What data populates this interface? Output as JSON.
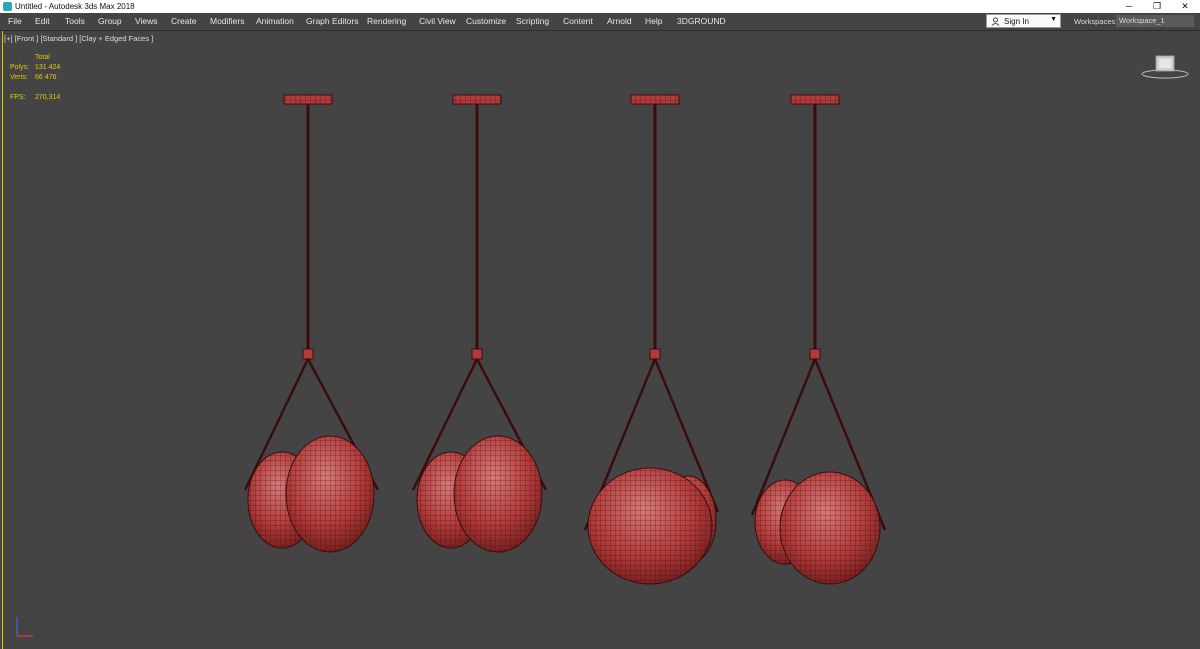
{
  "window": {
    "title": "Untitled - Autodesk 3ds Max 2018",
    "controls": {
      "minimize": "─",
      "restore": "❐",
      "close": "✕"
    }
  },
  "menu": {
    "items": [
      "File",
      "Edit",
      "Tools",
      "Group",
      "Views",
      "Create",
      "Modifiers",
      "Animation",
      "Graph Editors",
      "Rendering",
      "Civil View",
      "Customize",
      "Scripting",
      "Content",
      "Arnold",
      "Help",
      "3DGROUND"
    ]
  },
  "account": {
    "sign_in": "Sign In"
  },
  "workspaces": {
    "label": "Workspaces:",
    "value": "Workspace_1"
  },
  "viewport": {
    "label": "[+] [Front ] [Standard ] [Clay + Edged Faces ]",
    "stats": {
      "header": "Total",
      "polys_label": "Polys:",
      "polys_value": "131 424",
      "verts_label": "Verts:",
      "verts_value": "66 476",
      "fps_label": "FPS:",
      "fps_value": "270,314"
    }
  },
  "colors": {
    "viewport_bg": "#444444",
    "model_red": "#b23a3a",
    "wire": "#3a0d0d",
    "stats_yellow": "#e8c800"
  },
  "icons": [
    "app-icon",
    "user-icon",
    "chevron-down-icon",
    "viewcube-icon",
    "axis-gizmo-icon"
  ]
}
